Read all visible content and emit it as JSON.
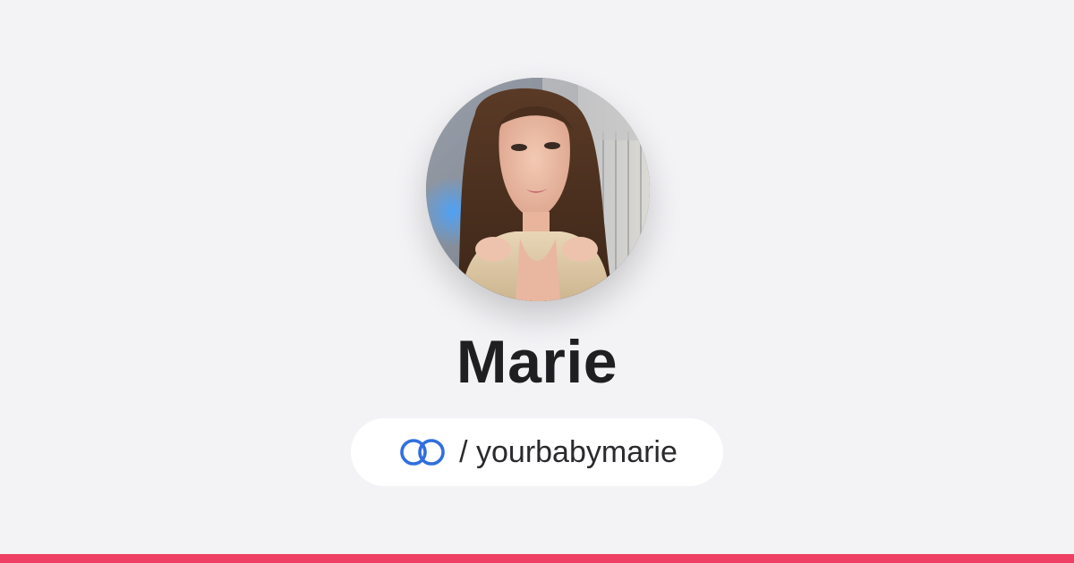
{
  "profile": {
    "display_name": "Marie",
    "handle": "/ yourbabymarie",
    "avatar_alt": "Marie"
  },
  "icons": {
    "brand": "linked-rings-icon"
  },
  "colors": {
    "background": "#f3f3f6",
    "brand_blue": "#2f6fe0",
    "accent_bar": "#ee3e63",
    "name_text": "#1f1f22",
    "pill_background": "#ffffff"
  }
}
